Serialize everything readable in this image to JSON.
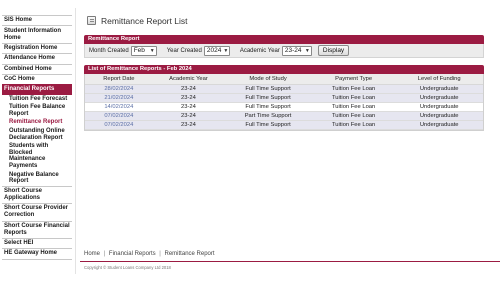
{
  "sidebar": {
    "items": [
      {
        "label": "SIS Home",
        "active": false
      },
      {
        "label": "Student Information Home",
        "active": false
      },
      {
        "label": "Registration Home",
        "active": false
      },
      {
        "label": "Attendance Home",
        "active": false
      },
      {
        "label": "Combined Home",
        "active": false
      },
      {
        "label": "CoC Home",
        "active": false
      },
      {
        "label": "Financial Reports",
        "active": true
      }
    ],
    "financial_sub": [
      "Tuition Fee Forecast",
      "Tuition Fee Balance Report",
      "Remittance Report",
      "Outstanding Online Declaration Report",
      "Students with Blocked Maintenance Payments",
      "Negative Balance Report"
    ],
    "bottom_items": [
      "Short Course Applications",
      "Short Course Provider Correction",
      "Short Course Financial Reports",
      "Select HEI",
      "HE Gateway Home"
    ]
  },
  "page": {
    "title": "Remittance Report List",
    "title_icon": "document-icon"
  },
  "filter": {
    "header": "Remittance Report",
    "month_label": "Month Created",
    "month_value": "Feb",
    "year_label": "Year Created",
    "year_value": "2024",
    "academic_label": "Academic Year",
    "academic_value": "23-24",
    "display_label": "Display"
  },
  "list": {
    "header": "List of Remittance Reports - Feb 2024",
    "columns": [
      "Report Date",
      "Academic Year",
      "Mode of Study",
      "Payment Type",
      "Level of Funding"
    ],
    "rows": [
      [
        "28/02/2024",
        "23-24",
        "Full Time Support",
        "Tuition Fee Loan",
        "Undergraduate"
      ],
      [
        "21/02/2024",
        "23-24",
        "Full Time Support",
        "Tuition Fee Loan",
        "Undergraduate"
      ],
      [
        "14/02/2024",
        "23-24",
        "Full Time Support",
        "Tuition Fee Loan",
        "Undergraduate"
      ],
      [
        "07/02/2024",
        "23-24",
        "Part Time Support",
        "Tuition Fee Loan",
        "Undergraduate"
      ],
      [
        "07/02/2024",
        "23-24",
        "Full Time Support",
        "Tuition Fee Loan",
        "Undergraduate"
      ]
    ]
  },
  "footer": {
    "breadcrumb": [
      "Home",
      "Financial Reports",
      "Remittance Report"
    ],
    "breadcrumb_sep": "|",
    "copyright": "Copyright © Student Loans Company Ltd 2018"
  },
  "colors": {
    "accent": "#9b1b42",
    "row_alt": "#e6e6f0",
    "date_link": "#5b6fa6"
  }
}
